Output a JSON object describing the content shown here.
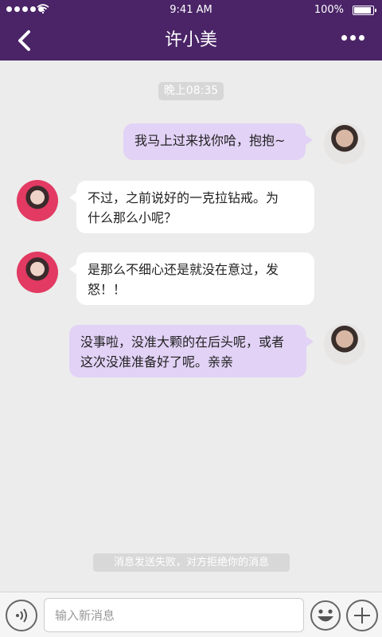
{
  "status_bar": {
    "time": "9:41 AM",
    "battery": "100%"
  },
  "header": {
    "title": "许小美"
  },
  "chat": {
    "time_divider": "晚上08:35",
    "messages": [
      {
        "from": "me",
        "line1": "我马上过来找你哈，抱抱~"
      },
      {
        "from": "other",
        "line1": "不过，之前说好的一克拉钻戒。为",
        "line2": "什么那么小呢？"
      },
      {
        "from": "other",
        "line1": "是那么不细心还是就没在意过，发",
        "line2": "怒！！"
      },
      {
        "from": "me",
        "line1": "没事啦，没准大颗的在后头呢，或者",
        "line2": "这次没准准备好了呢。亲亲"
      }
    ],
    "send_notice": "消息发送失败，对方拒绝你的消息"
  },
  "input": {
    "placeholder": "输入新消息"
  },
  "icons": [
    "back-icon",
    "more-icon",
    "voice-icon",
    "emoji-icon",
    "plus-icon",
    "wifi-icon",
    "battery-icon"
  ],
  "colors": {
    "header_bg": "#4a2467",
    "my_bubble": "#e2d2f6",
    "their_bubble": "#ffffff",
    "background": "#ececec"
  }
}
